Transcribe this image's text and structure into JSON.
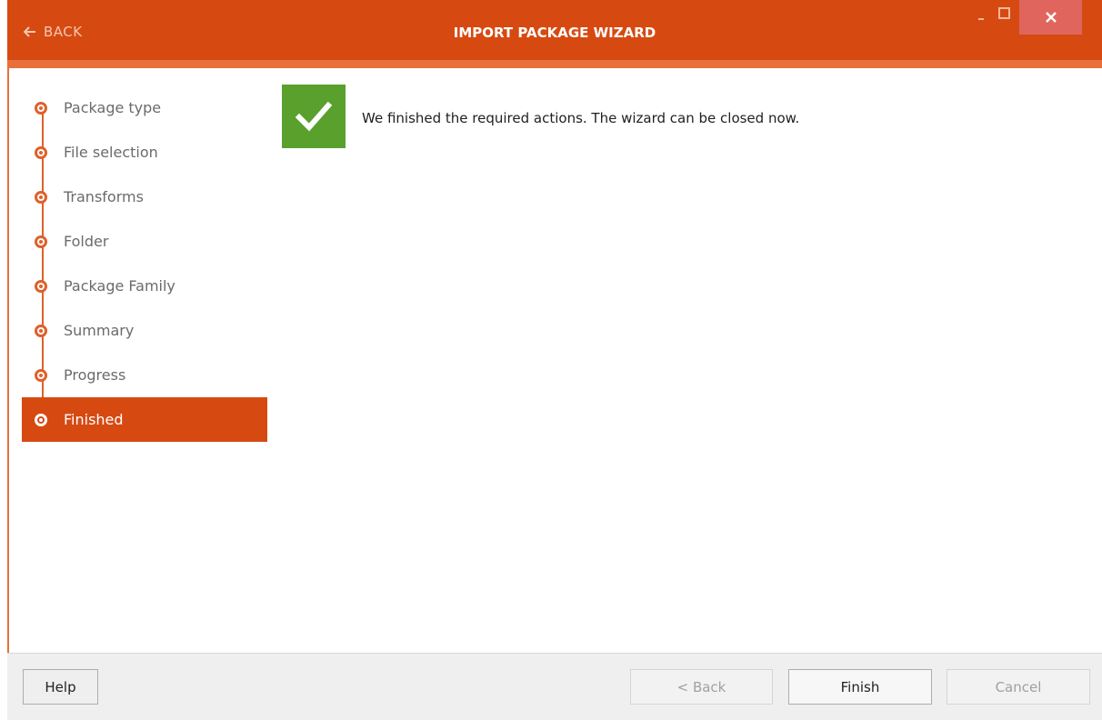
{
  "window": {
    "back_label": "BACK",
    "title": "IMPORT PACKAGE WIZARD",
    "controls": {
      "minimize": "minimize-icon",
      "maximize": "maximize-icon",
      "close": "close-icon"
    },
    "accent_color": "#d64a12",
    "accent_light": "#e8703b"
  },
  "steps": [
    {
      "label": "Package type",
      "active": false
    },
    {
      "label": "File selection",
      "active": false
    },
    {
      "label": "Transforms",
      "active": false
    },
    {
      "label": "Folder",
      "active": false
    },
    {
      "label": "Package Family",
      "active": false
    },
    {
      "label": "Summary",
      "active": false
    },
    {
      "label": "Progress",
      "active": false
    },
    {
      "label": "Finished",
      "active": true
    }
  ],
  "content": {
    "status_icon": "checkmark-icon",
    "status_color": "#5aa02c",
    "message": "We finished the required actions. The wizard can be closed now."
  },
  "footer": {
    "help_label": "Help",
    "back_label": "< Back",
    "finish_label": "Finish",
    "cancel_label": "Cancel",
    "back_enabled": false,
    "finish_enabled": true,
    "cancel_enabled": false
  }
}
